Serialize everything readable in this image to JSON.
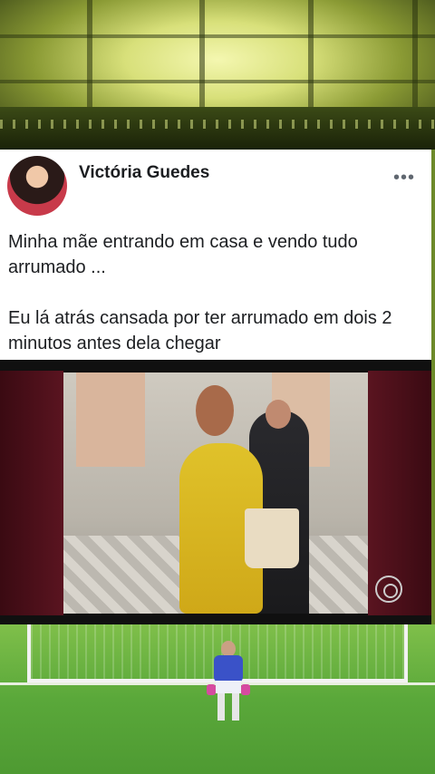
{
  "post": {
    "author": "Victória Guedes",
    "more_icon": "•••",
    "text_lines": [
      "Minha mãe entrando em casa e vendo tudo arrumado ...",
      "Eu lá atrás cansada por ter arrumado em dois 2 minutos antes dela chegar"
    ]
  },
  "video": {
    "channel_logo": "globo-logo-icon"
  },
  "colors": {
    "card_background": "#ffffff",
    "text": "#1c1e21",
    "dress": "#e0c22a",
    "pitch": "#5aa83a",
    "keeper_jersey": "#3a52c8"
  }
}
